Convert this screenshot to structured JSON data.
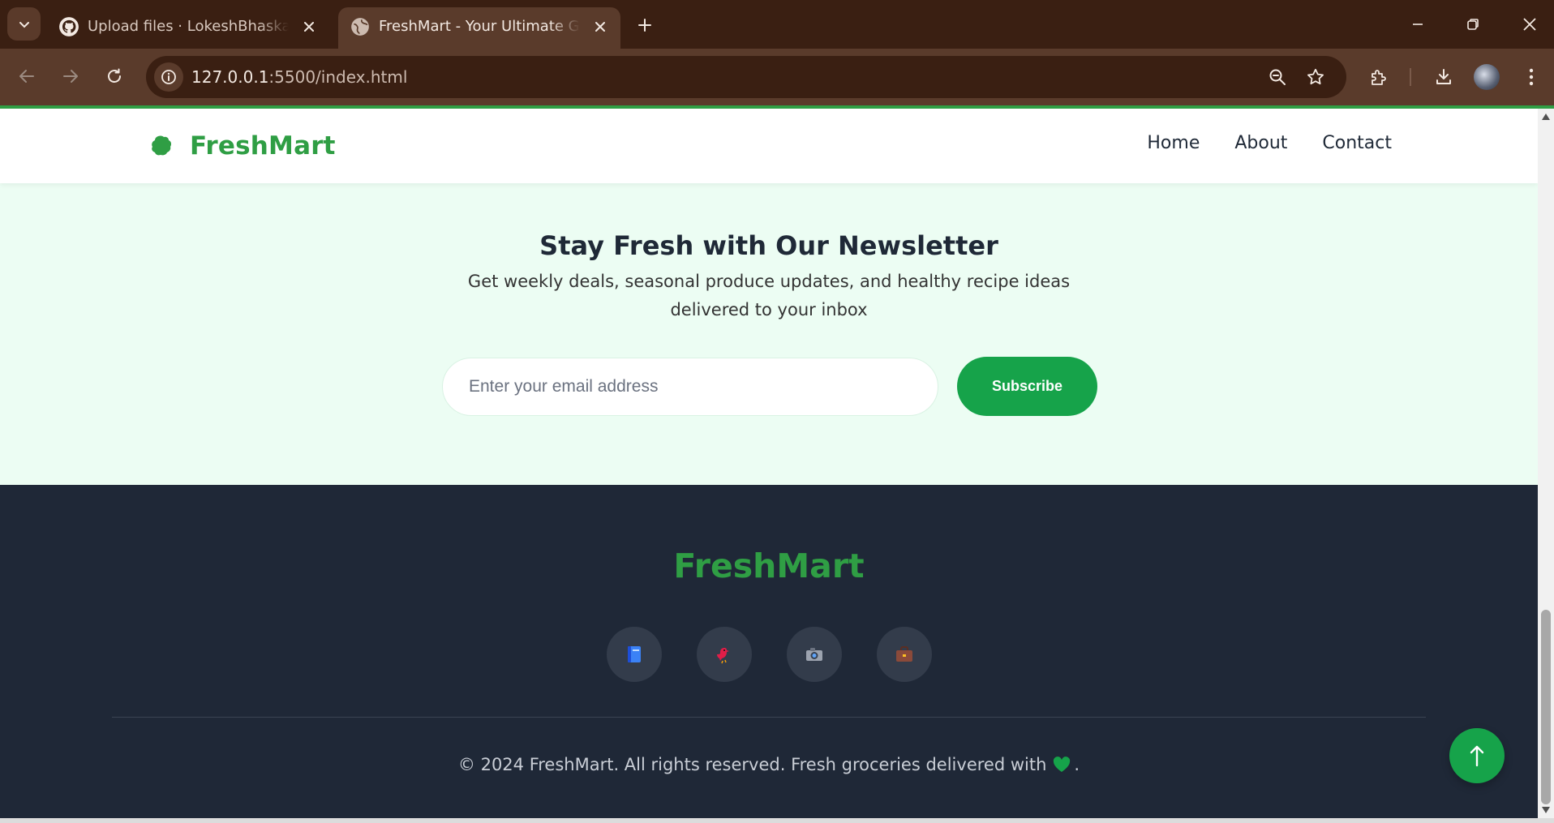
{
  "browser": {
    "tabs": [
      {
        "title": "Upload files · LokeshBhaskarNR/",
        "icon": "github-icon",
        "active": false
      },
      {
        "title": "FreshMart - Your Ultimate Grocery",
        "icon": "globe-icon",
        "active": true
      }
    ],
    "url_host": "127.0.0.1",
    "url_path": ":5500/index.html"
  },
  "site": {
    "brand": "FreshMart",
    "brand_icon": "leaf-icon",
    "nav": [
      "Home",
      "About",
      "Contact"
    ]
  },
  "newsletter": {
    "title": "Stay Fresh with Our Newsletter",
    "description": "Get weekly deals, seasonal produce updates, and healthy recipe ideas delivered to your inbox",
    "email_placeholder": "Enter your email address",
    "email_value": "",
    "button": "Subscribe"
  },
  "footer": {
    "brand": "FreshMart",
    "socials": [
      "book-icon",
      "bird-icon",
      "camera-icon",
      "briefcase-icon"
    ],
    "copyright": "© 2024 FreshMart. All rights reserved. Fresh groceries delivered with",
    "copyright_end": ".",
    "heart_icon": "green-heart-icon"
  },
  "scroll_top_icon": "arrow-up-icon",
  "colors": {
    "brand_green": "#2f9e44",
    "button_green": "#16a34a",
    "footer_bg": "#1f2837",
    "newsletter_bg": "#ecfdf3",
    "chrome_dark": "#3a1f12",
    "chrome_mid": "#5a3b2b"
  }
}
